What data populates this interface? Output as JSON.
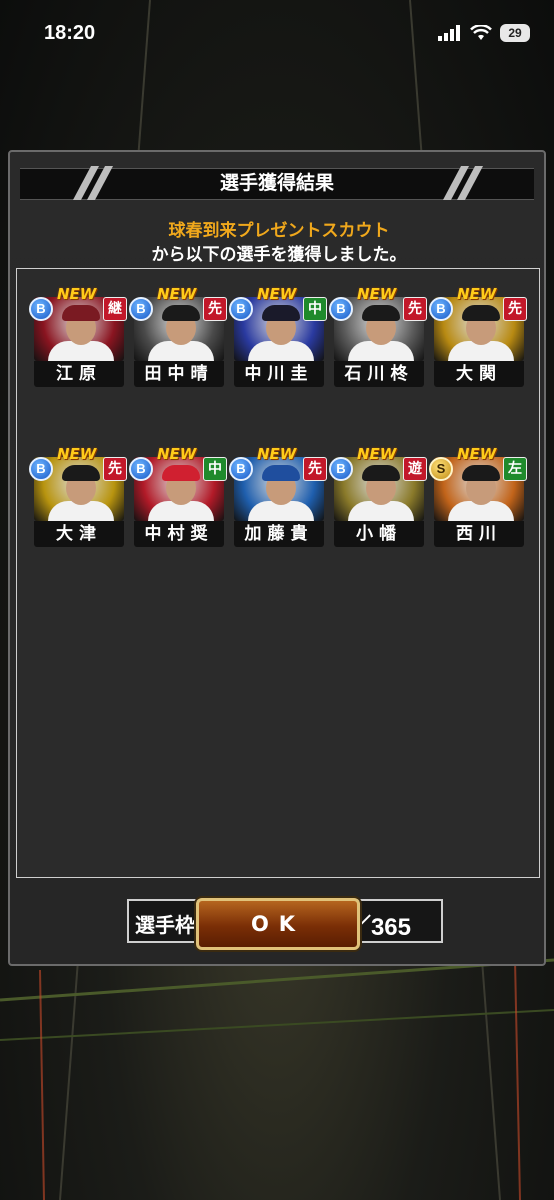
{
  "status_bar": {
    "time": "18:20",
    "battery": "29"
  },
  "dialog": {
    "title": "選手獲得結果",
    "scout_name": "球春到来プレゼントスカウト",
    "message": "から以下の選手を獲得しました。"
  },
  "players": [
    {
      "name": "江原",
      "grade": "B",
      "position": "継",
      "new_label": "NEW",
      "pos_color": "red",
      "bg": "#8a1420",
      "cap": "#7a1a22"
    },
    {
      "name": "田中晴",
      "grade": "B",
      "position": "先",
      "new_label": "NEW",
      "pos_color": "red",
      "bg": "#4a4a4a",
      "cap": "#1a1a1a"
    },
    {
      "name": "中川圭",
      "grade": "B",
      "position": "中",
      "new_label": "NEW",
      "pos_color": "green",
      "bg": "#2a3aa0",
      "cap": "#1a1a2a"
    },
    {
      "name": "石川柊",
      "grade": "B",
      "position": "先",
      "new_label": "NEW",
      "pos_color": "red",
      "bg": "#5a5a5a",
      "cap": "#1a1a1a"
    },
    {
      "name": "大関",
      "grade": "B",
      "position": "先",
      "new_label": "NEW",
      "pos_color": "red",
      "bg": "#b88a12",
      "cap": "#1a1a1a"
    },
    {
      "name": "大津",
      "grade": "B",
      "position": "先",
      "new_label": "NEW",
      "pos_color": "red",
      "bg": "#b8940f",
      "cap": "#1a1a1a"
    },
    {
      "name": "中村奨",
      "grade": "B",
      "position": "中",
      "new_label": "NEW",
      "pos_color": "green",
      "bg": "#b21a28",
      "cap": "#d02030"
    },
    {
      "name": "加藤貴",
      "grade": "B",
      "position": "先",
      "new_label": "NEW",
      "pos_color": "red",
      "bg": "#1f5fae",
      "cap": "#1f4e9e"
    },
    {
      "name": "小幡",
      "grade": "B",
      "position": "遊",
      "new_label": "NEW",
      "pos_color": "red",
      "bg": "#8a7a2a",
      "cap": "#1a1a1a"
    },
    {
      "name": "西川",
      "grade": "S",
      "position": "左",
      "new_label": "NEW",
      "pos_color": "green",
      "bg": "#c2641a",
      "cap": "#1a1a1a"
    }
  ],
  "capacity": {
    "label": "選手枠：",
    "value": "155／365"
  },
  "ok_button": {
    "label": "OK"
  }
}
